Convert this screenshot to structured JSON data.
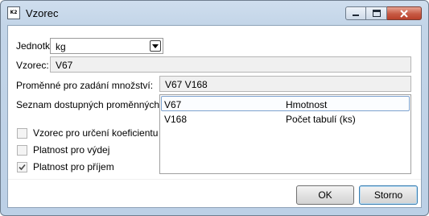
{
  "window": {
    "title": "Vzorec",
    "icon": "formula-app-icon",
    "icon_text": "K2",
    "close_color": "#c75a44"
  },
  "form": {
    "unit_label": "Jednotka:",
    "unit_value": "kg",
    "formula_label": "Vzorec:",
    "formula_value": "V67",
    "variables_label": "Proměnné pro zadání množství:",
    "variables_value": "V67 V168",
    "available_label": "Seznam dostupných proměnných:"
  },
  "variables": [
    {
      "code": "V67",
      "name": "Hmotnost",
      "selected": true
    },
    {
      "code": "V168",
      "name": "Počet tabulí (ks)",
      "selected": false
    }
  ],
  "checkboxes": [
    {
      "label": "Vzorec pro určení koeficientu",
      "checked": false
    },
    {
      "label": "Platnost pro výdej",
      "checked": false
    },
    {
      "label": "Platnost pro příjem",
      "checked": true
    }
  ],
  "buttons": {
    "ok": "OK",
    "cancel": "Storno"
  }
}
